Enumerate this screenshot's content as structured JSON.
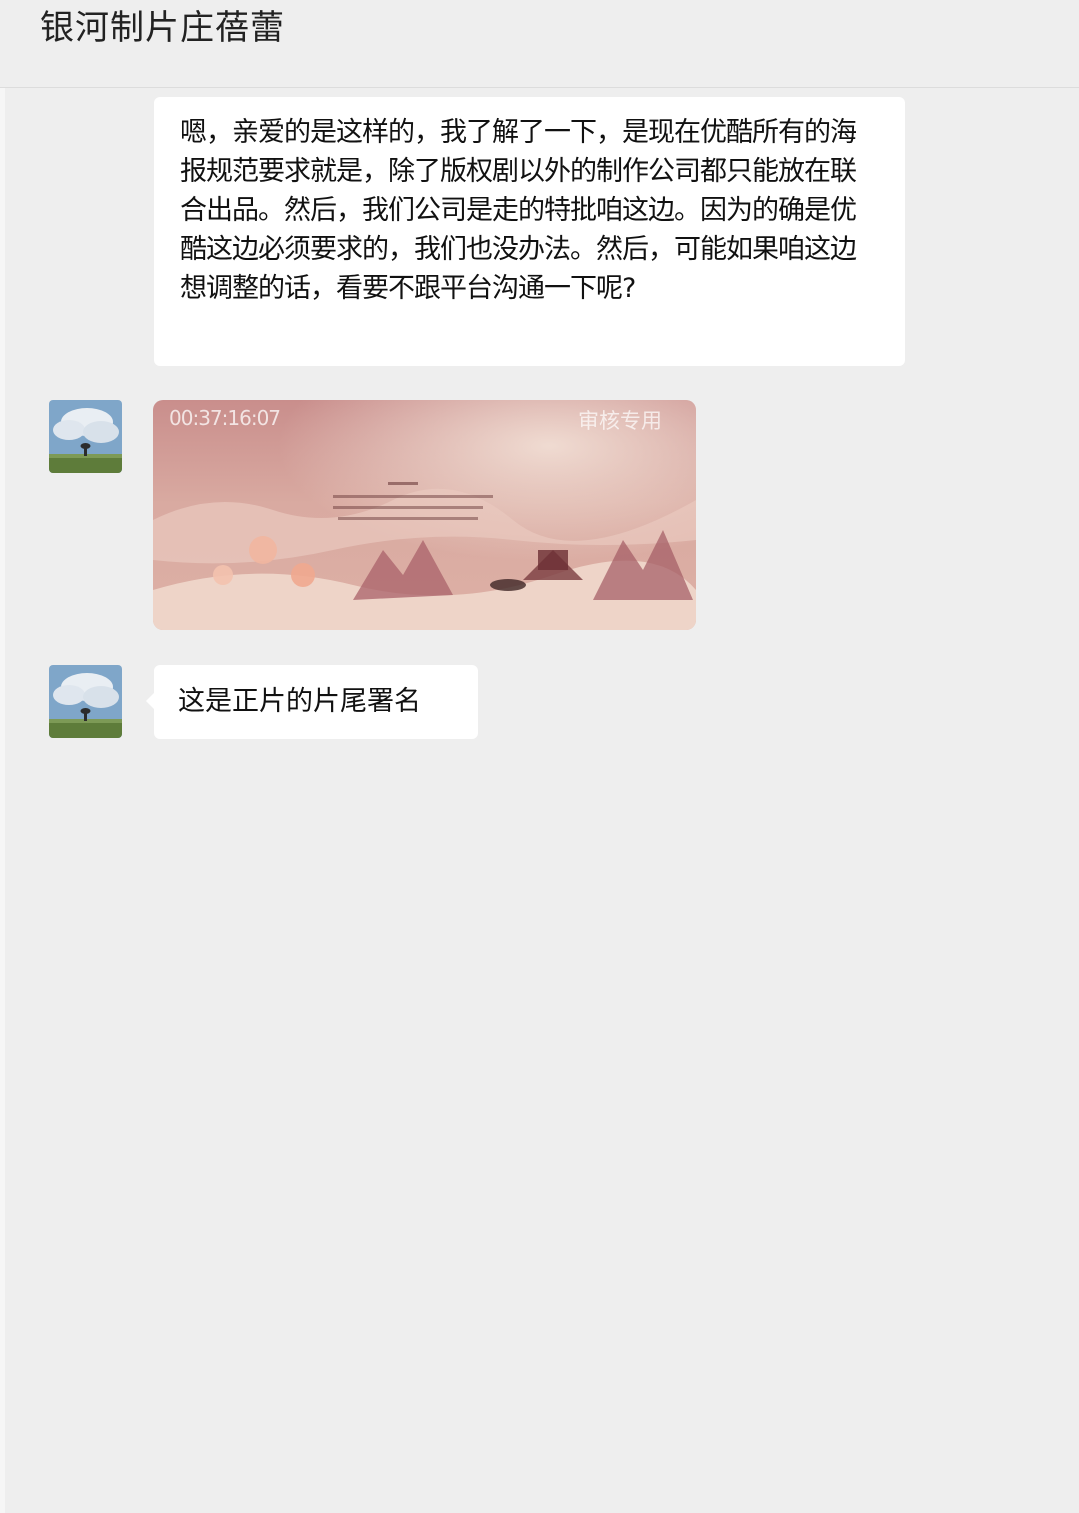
{
  "header": {
    "title": "银河制片庄蓓蕾"
  },
  "messages": [
    {
      "type": "text",
      "text": "嗯，亲爱的是这样的，我了解了一下，是现在优酷所有的海报规范要求就是，除了版权剧以外的制作公司都只能放在联合出品。然后，我们公司是走的特批咱这边。因为的确是优酷这边必须要求的，我们也没办法。然后，可能如果咱这边想调整的话，看要不跟平台沟通一下呢?"
    },
    {
      "type": "video",
      "timestamp": "00:37:16:07",
      "watermark": "审核专用"
    },
    {
      "type": "text",
      "text": "这是正片的片尾署名"
    }
  ],
  "colors": {
    "background": "#eeeeee",
    "bubble": "#ffffff",
    "text": "#111111"
  }
}
